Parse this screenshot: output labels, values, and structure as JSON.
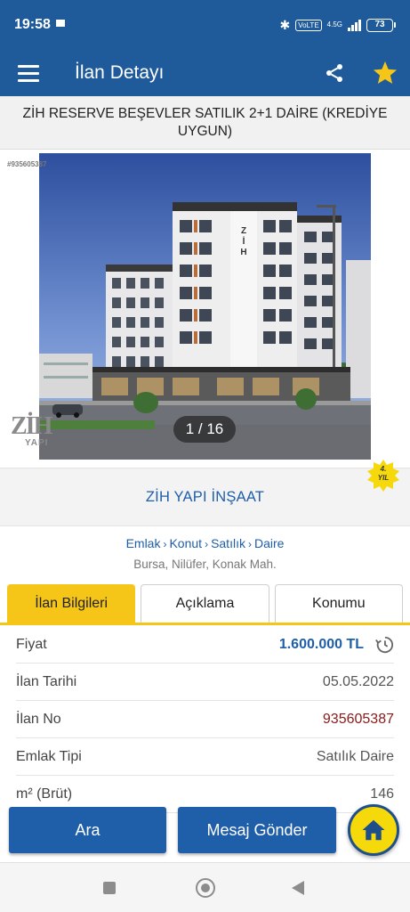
{
  "status_bar": {
    "time": "19:58",
    "network_type": "4.5G",
    "volte": "VoLTE",
    "battery": "73"
  },
  "app_bar": {
    "title": "İlan Detayı",
    "menu_icon": "hamburger-menu-icon",
    "share_icon": "share-icon",
    "favorite_icon": "star-icon",
    "favorite_color": "#f5c518",
    "background_color": "#1f5a9a"
  },
  "listing": {
    "title": "ZİH RESERVE BEŞEVLER SATILIK 2+1 DAİRE (KREDİYE UYGUN)",
    "id_watermark": "#935605387",
    "photo_counter": "1 / 16",
    "company_logo_text": "ZİH",
    "company_logo_subtext": "YAPI",
    "year_badge_number": "4.",
    "year_badge_label": "YIL",
    "company_name": "ZİH YAPI İNŞAAT",
    "breadcrumb": [
      "Emlak",
      "Konut",
      "Satılık",
      "Daire"
    ],
    "breadcrumb_separator": "›",
    "location": "Bursa, Nilüfer, Konak Mah."
  },
  "tabs": [
    {
      "label": "İlan Bilgileri",
      "active": true
    },
    {
      "label": "Açıklama",
      "active": false
    },
    {
      "label": "Konumu",
      "active": false
    }
  ],
  "info_rows": [
    {
      "label": "Fiyat",
      "value": "1.600.000 TL"
    },
    {
      "label": "İlan Tarihi",
      "value": "05.05.2022"
    },
    {
      "label": "İlan No",
      "value": "935605387"
    },
    {
      "label": "Emlak Tipi",
      "value": "Satılık Daire"
    },
    {
      "label": "m² (Brüt)",
      "value": "146"
    }
  ],
  "actions": {
    "search_label": "Ara",
    "message_label": "Mesaj Gönder",
    "home_icon": "home-icon"
  },
  "colors": {
    "primary_blue": "#1f5ea8",
    "accent_yellow": "#f5c518",
    "listing_no_red": "#8b1a1a"
  }
}
